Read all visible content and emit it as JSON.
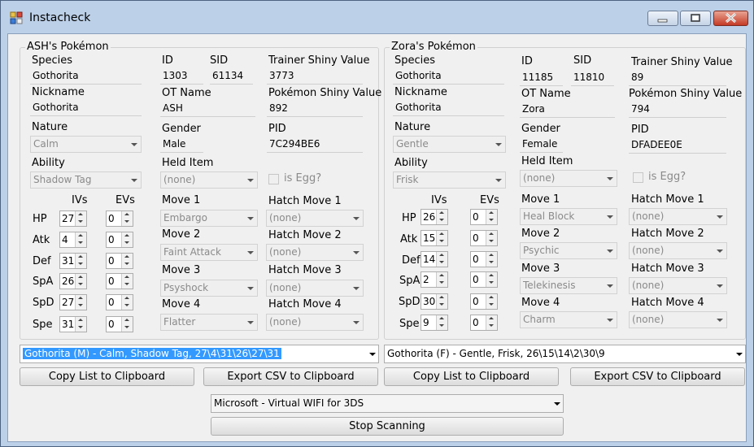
{
  "window": {
    "title": "Instacheck",
    "minimize_icon": "minimize-icon",
    "maximize_icon": "maximize-icon",
    "close_icon": "close-icon"
  },
  "labels": {
    "species": "Species",
    "nickname": "Nickname",
    "nature": "Nature",
    "ability": "Ability",
    "id": "ID",
    "sid": "SID",
    "ot_name": "OT Name",
    "gender": "Gender",
    "held_item": "Held Item",
    "trainer_shiny_value": "Trainer Shiny Value",
    "pokemon_shiny_value": "Pokémon Shiny Value",
    "pid": "PID",
    "is_egg": "is Egg?",
    "ivs": "IVs",
    "evs": "EVs",
    "stats": [
      "HP",
      "Atk",
      "Def",
      "SpA",
      "SpD",
      "Spe"
    ],
    "moves": [
      "Move 1",
      "Move 2",
      "Move 3",
      "Move 4"
    ],
    "hatch_moves": [
      "Hatch Move 1",
      "Hatch Move 2",
      "Hatch Move 3",
      "Hatch Move 4"
    ]
  },
  "left": {
    "title": "ASH's Pokémon",
    "species": "Gothorita",
    "nickname": "Gothorita",
    "nature": "Calm",
    "ability": "Shadow Tag",
    "id": "1303",
    "sid": "61134",
    "ot_name": "ASH",
    "gender": "Male",
    "held_item": "(none)",
    "trainer_shiny_value": "3773",
    "pokemon_shiny_value": "892",
    "pid": "7C294BE6",
    "ivs": [
      "27",
      "4",
      "31",
      "26",
      "27",
      "31"
    ],
    "evs": [
      "0",
      "0",
      "0",
      "0",
      "0",
      "0"
    ],
    "moves": [
      "Embargo",
      "Faint Attack",
      "Psyshock",
      "Flatter"
    ],
    "hatch_moves": [
      "(none)",
      "(none)",
      "(none)",
      "(none)"
    ],
    "summary": "Gothorita (M) - Calm, Shadow Tag, 27\\4\\31\\26\\27\\31",
    "copy_button": "Copy List to Clipboard",
    "export_button": "Export CSV to Clipboard"
  },
  "right": {
    "title": "Zora's Pokémon",
    "species": "Gothorita",
    "nickname": "Gothorita",
    "nature": "Gentle",
    "ability": "Frisk",
    "id": "11185",
    "sid": "11810",
    "ot_name": "Zora",
    "gender": "Female",
    "held_item": "(none)",
    "trainer_shiny_value": "89",
    "pokemon_shiny_value": "794",
    "pid": "DFADEE0E",
    "ivs": [
      "26",
      "15",
      "14",
      "2",
      "30",
      "9"
    ],
    "evs": [
      "0",
      "0",
      "0",
      "0",
      "0",
      "0"
    ],
    "moves": [
      "Heal Block",
      "Psychic",
      "Telekinesis",
      "Charm"
    ],
    "hatch_moves": [
      "(none)",
      "(none)",
      "(none)",
      "(none)"
    ],
    "summary": "Gothorita (F) - Gentle, Frisk, 26\\15\\14\\2\\30\\9",
    "copy_button": "Copy List to Clipboard",
    "export_button": "Export CSV to Clipboard"
  },
  "bottom": {
    "adapter": "Microsoft - Virtual WIFI for 3DS",
    "scan_button": "Stop Scanning"
  }
}
